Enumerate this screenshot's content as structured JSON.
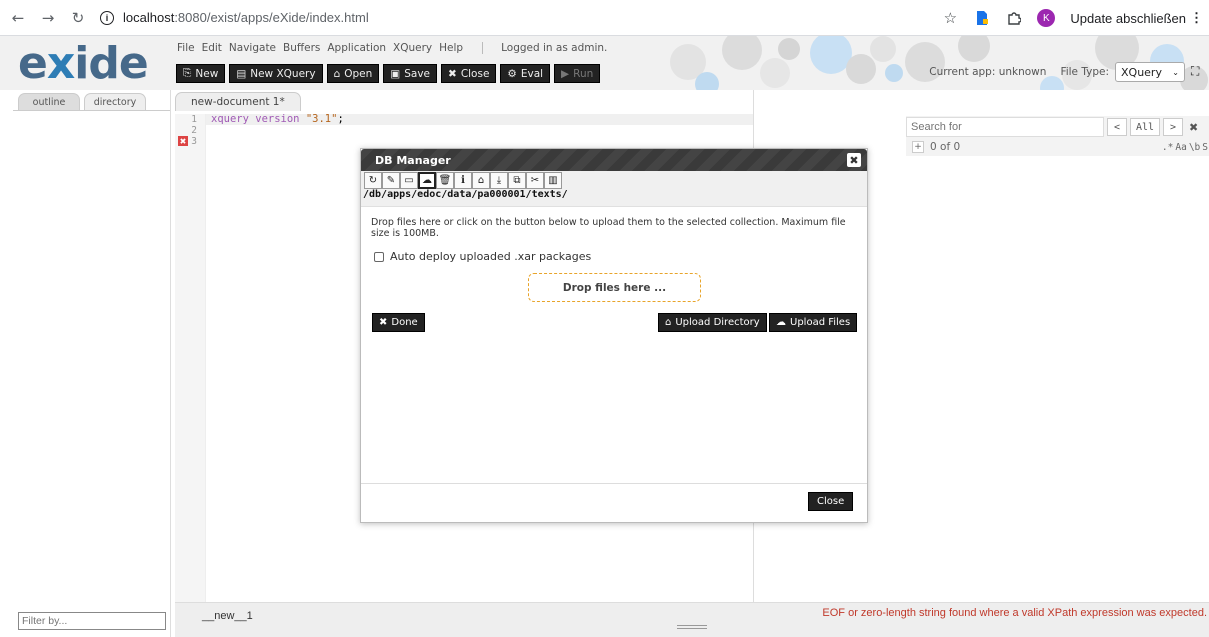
{
  "browser": {
    "url_host": "localhost",
    "url_rest": ":8080/exist/apps/eXide/index.html",
    "profile_initial": "K",
    "update_label": "Update abschließen"
  },
  "app": {
    "logo": "eXide",
    "menu": [
      "File",
      "Edit",
      "Navigate",
      "Buffers",
      "Application",
      "XQuery",
      "Help"
    ],
    "logged_in": "Logged in as admin.",
    "toolbar": {
      "new": "New",
      "new_xquery": "New XQuery",
      "open": "Open",
      "save": "Save",
      "close": "Close",
      "eval": "Eval",
      "run": "Run"
    },
    "current_app": "Current app: unknown",
    "file_type_label": "File Type:",
    "file_type_value": "XQuery"
  },
  "sidebar": {
    "tabs": [
      "outline",
      "directory"
    ],
    "filter_placeholder": "Filter by..."
  },
  "editor": {
    "tab": "new-document 1*",
    "line_numbers": [
      "1",
      "2",
      "3"
    ],
    "code_keyword": "xquery version",
    "code_string": "\"3.1\"",
    "code_end": ";"
  },
  "search": {
    "placeholder": "Search for",
    "all_label": "All",
    "count": "0 of 0",
    "options": [
      ".*",
      "Aa",
      "\\b",
      "S"
    ]
  },
  "status": {
    "doc_name": "__new__1",
    "error": "EOF or zero-length string found where a valid XPath expression was expected."
  },
  "dialog": {
    "title": "DB Manager",
    "path": "/db/apps/edoc/data/pa000001/texts/",
    "description": "Drop files here or click on the button below to upload them to the selected collection. Maximum file size is 100MB.",
    "auto_deploy": "Auto deploy uploaded .xar packages",
    "drop_zone": "Drop files here ...",
    "done": "Done",
    "upload_directory": "Upload Directory",
    "upload_files": "Upload Files",
    "close": "Close"
  }
}
